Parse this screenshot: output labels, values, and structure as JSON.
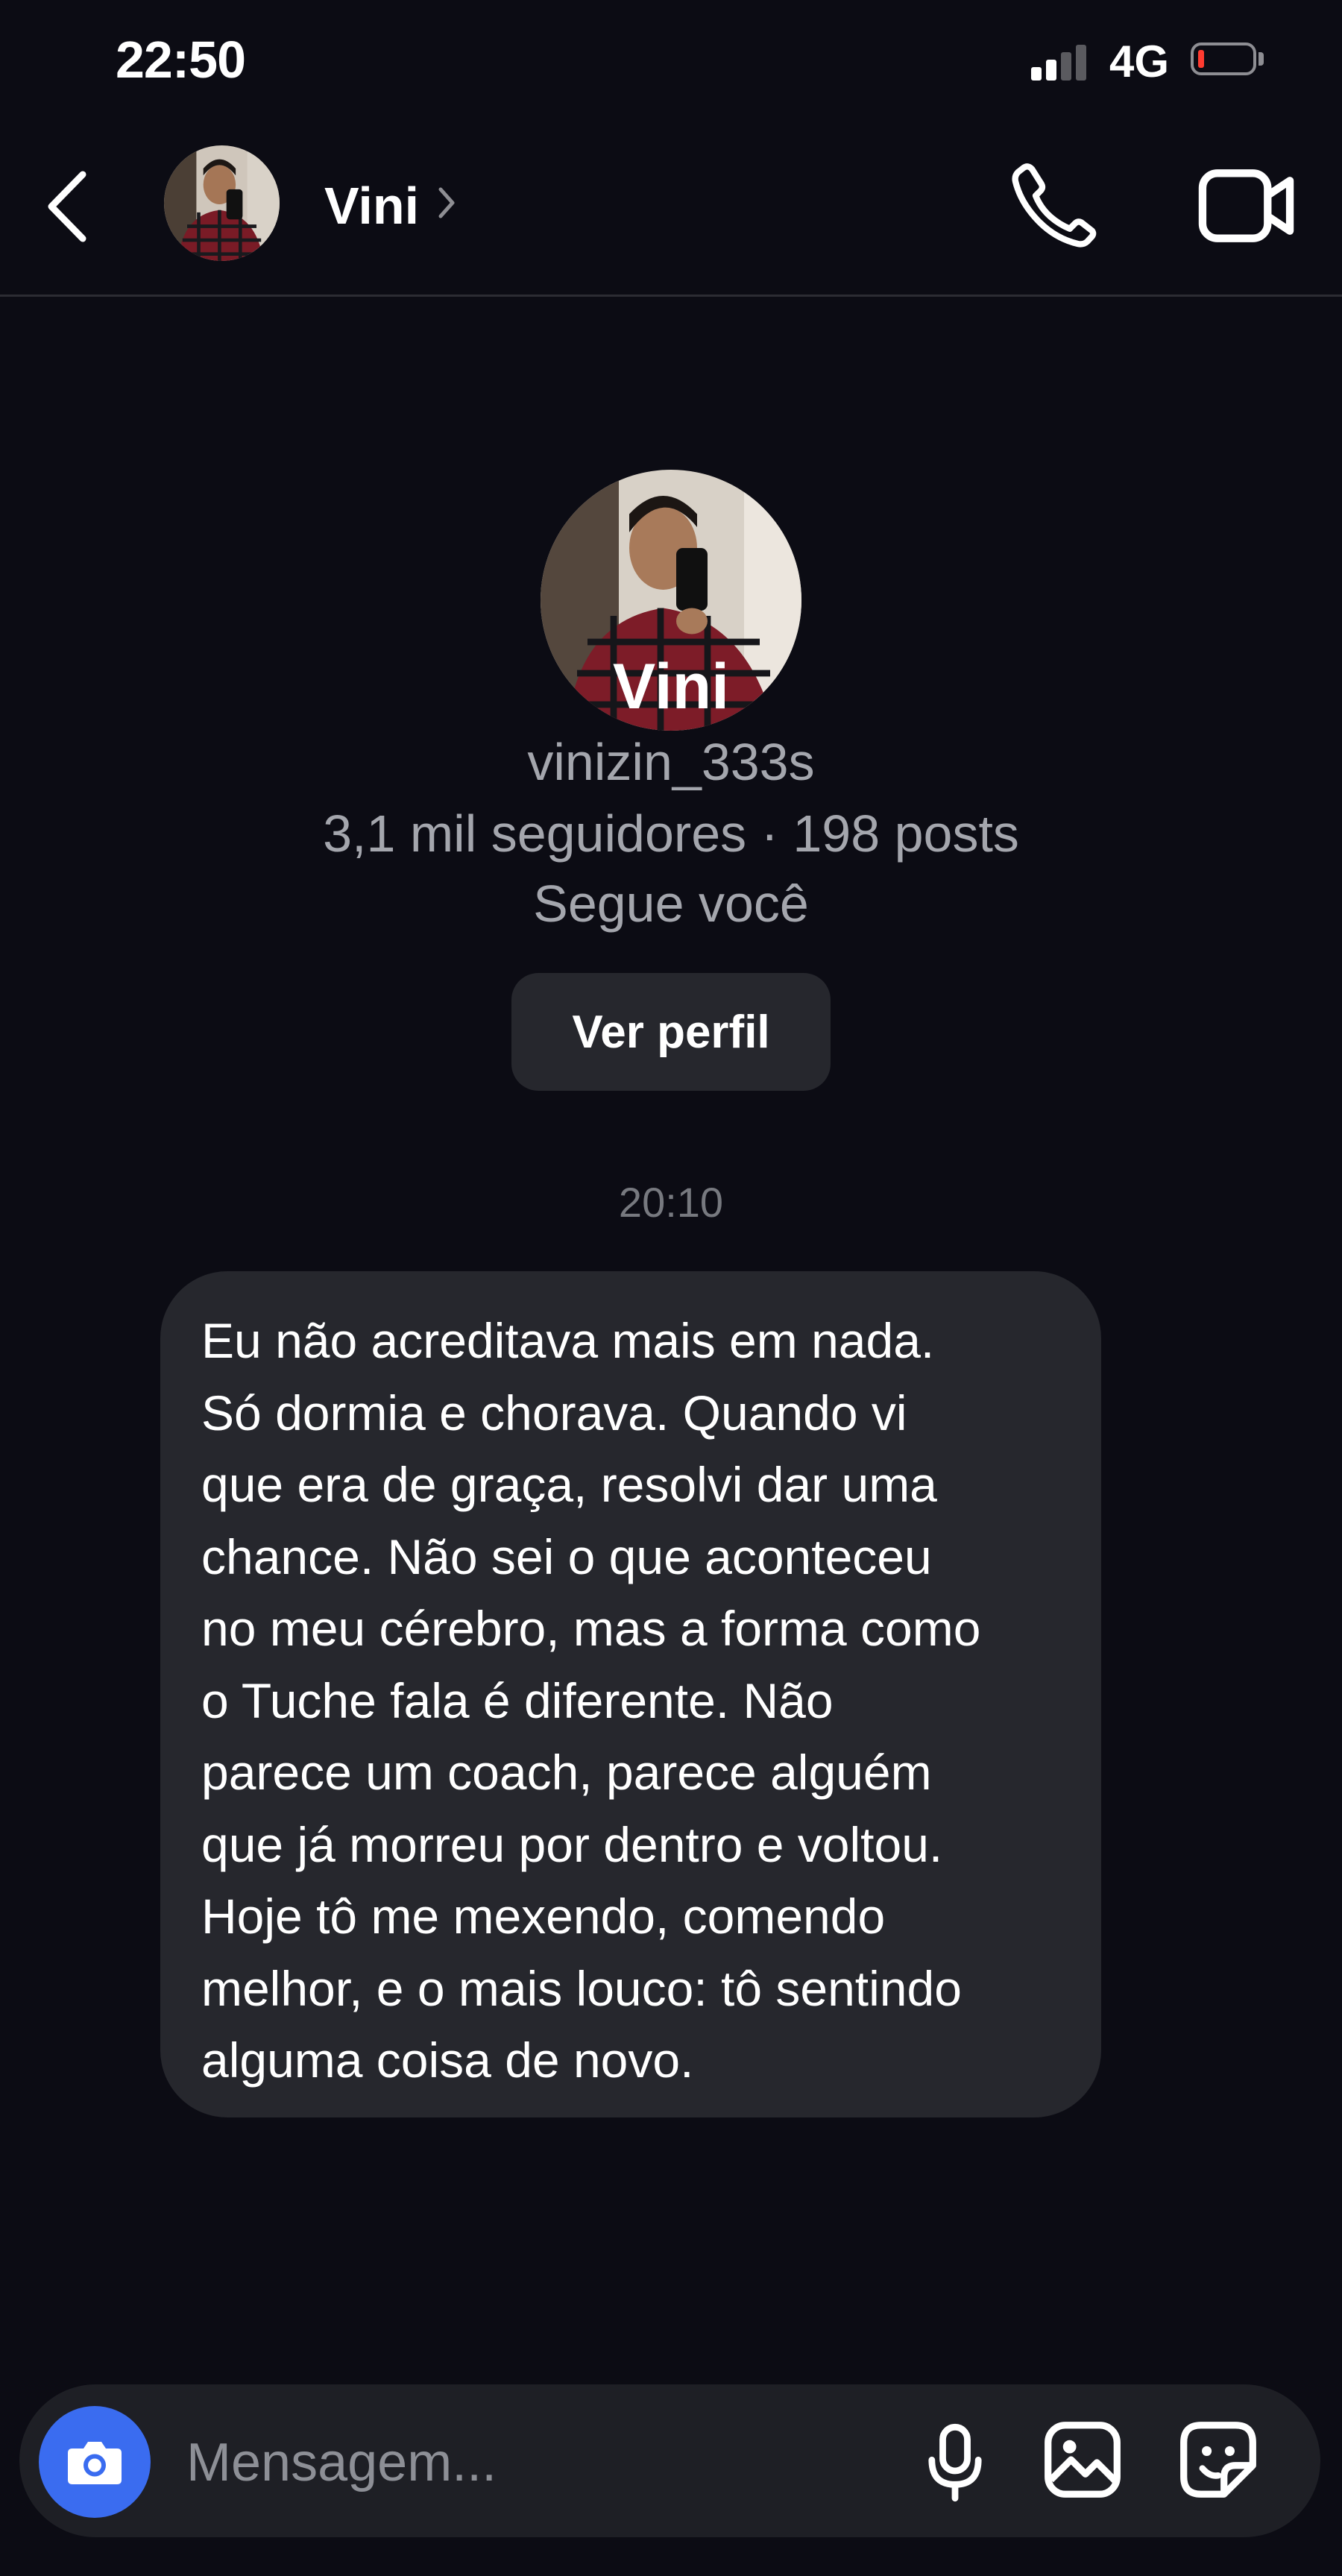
{
  "status_bar": {
    "time": "22:50",
    "network": "4G",
    "battery_color": "#ff3b30"
  },
  "header": {
    "name": "Vini",
    "back_icon": "chevron-left-icon",
    "call_icon": "phone-icon",
    "video_icon": "video-camera-icon"
  },
  "profile": {
    "name": "Vini",
    "username": "vinizin_333s",
    "stats": "3,1 mil seguidores · 198 posts",
    "follows_you": "Segue você",
    "view_profile_label": "Ver perfil"
  },
  "conversation": {
    "timestamp": "20:10",
    "messages": [
      {
        "lines": [
          "Eu não acreditava mais em nada.",
          "Só dormia e chorava. Quando vi",
          "que era de graça, resolvi dar uma",
          "chance. Não sei o que aconteceu",
          "no meu cérebro, mas a forma como",
          "o Tuche fala é diferente. Não",
          "parece um coach, parece alguém",
          "que já morreu por dentro e voltou.",
          "Hoje tô me mexendo, comendo",
          "melhor, e o mais louco: tô sentindo",
          "alguma coisa de novo."
        ]
      }
    ]
  },
  "composer": {
    "placeholder": "Mensagem...",
    "camera_icon": "camera-icon",
    "mic_icon": "microphone-icon",
    "gallery_icon": "image-icon",
    "sticker_icon": "sticker-icon",
    "camera_color": "#3a6cf0"
  }
}
